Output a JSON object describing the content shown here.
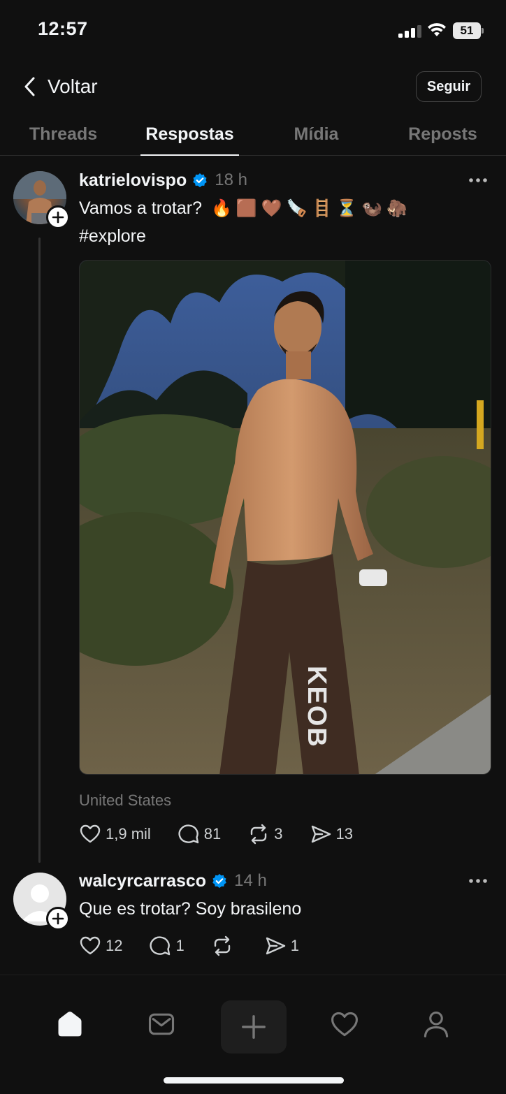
{
  "status_bar": {
    "time": "12:57",
    "battery": "51"
  },
  "header": {
    "back_label": "Voltar",
    "follow_label": "Seguir"
  },
  "tabs": [
    {
      "label": "Threads",
      "active": false
    },
    {
      "label": "Respostas",
      "active": true
    },
    {
      "label": "Mídia",
      "active": false
    },
    {
      "label": "Reposts",
      "active": false
    }
  ],
  "post": {
    "username": "katrielovispo",
    "time_ago": "18 h",
    "text": "Vamos a trotar?",
    "emojis": [
      "🔥",
      "🟫",
      "🤎",
      "🪚",
      "🪜",
      "⏳",
      "🦦",
      "🦣"
    ],
    "hashtag": "#explore",
    "location": "United States",
    "photo_text": "KEOB",
    "likes": "1,9 mil",
    "replies": "81",
    "reposts": "3",
    "shares": "13"
  },
  "reply": {
    "username": "walcyrcarrasco",
    "time_ago": "14 h",
    "text": "Que es trotar? Soy brasileno",
    "likes": "12",
    "replies": "1",
    "reposts": "",
    "shares": "1"
  },
  "nav": [
    "home-icon",
    "inbox-icon",
    "create-icon",
    "activity-icon",
    "profile-icon"
  ]
}
